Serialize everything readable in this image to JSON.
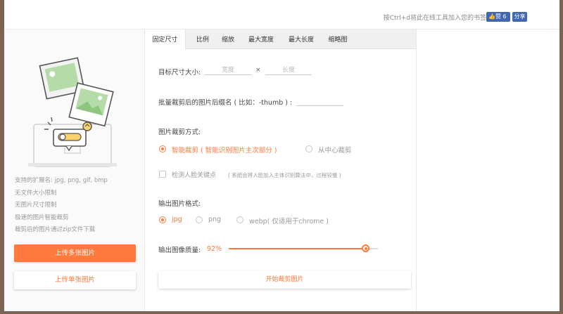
{
  "topbar": {
    "bookmark_tip": "按Ctrl+d将此在线工具加入您的书签",
    "like_label": "赞 6",
    "share_label": "分享"
  },
  "left": {
    "features": [
      "支持的扩展名: jpg, png, gif, bmp",
      "无文件大小限制",
      "无图片尺寸限制",
      "极速的图片智能裁剪",
      "裁剪后的图片通过zip文件下载"
    ],
    "upload_multi_label": "上传多张图片",
    "upload_single_label": "上传单张图片"
  },
  "tabs": [
    "固定尺寸",
    "比例",
    "缩放",
    "最大宽度",
    "最大长度",
    "缩略图"
  ],
  "form": {
    "target_size_label": "目标尺寸大小:",
    "width_placeholder": "宽度",
    "times_symbol": "×",
    "height_placeholder": "长度",
    "suffix_label": "批量裁剪后的图片后缀名 ( 比如：-thumb ) :",
    "crop_mode_label": "图片裁剪方式:",
    "crop_smart": "智能裁剪 ( 智能识别图片主次部分 )",
    "crop_center": "从中心裁剪",
    "face_detect_label": "检测人脸关键点",
    "face_detect_note": "( 系统会将人脸加入主体识别算法中，过程较慢 )",
    "format_label": "输出图片格式:",
    "formats": [
      "jpg",
      "png",
      "webp( 仅适用于chrome )"
    ],
    "selected_format": "jpg",
    "quality_label": "输出图像质量:",
    "quality_value": "92%",
    "quality_fraction": 0.92,
    "start_label": "开始裁剪图片"
  },
  "colors": {
    "accent": "#ff7a3c",
    "facebook": "#4267b2",
    "background": "#7b6453"
  }
}
